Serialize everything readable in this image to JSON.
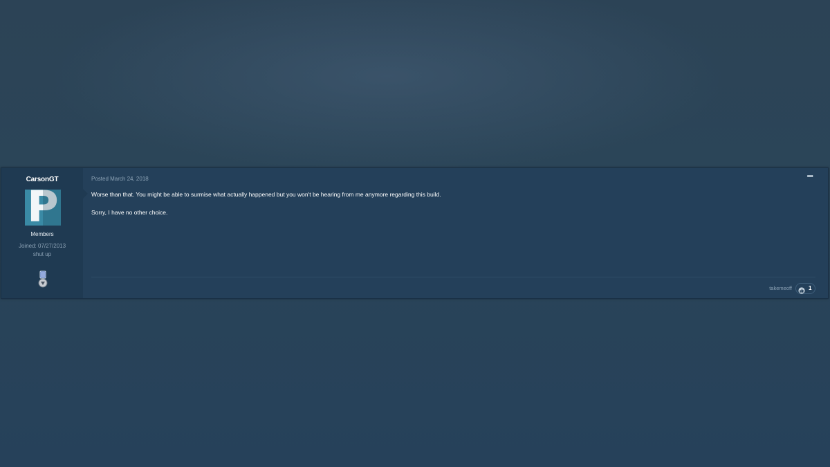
{
  "post": {
    "author": {
      "name": "CarsonGT",
      "avatar_letter": "P",
      "avatar_color": "#3a8aa5",
      "group": "Members",
      "joined": "Joined: 07/27/2013",
      "tagline": "shut up",
      "badge_icon": "rank-badge-icon"
    },
    "meta": {
      "posted": "Posted March 24, 2018"
    },
    "menu_label": "•••",
    "content": {
      "paragraph_1": "Worse than that. You might be able to surmise what actually happened but you won't be hearing from me anymore regarding this build.",
      "paragraph_2": "Sorry, I have no other choice."
    },
    "reactions": {
      "reactor": "takemeoff",
      "icon": "like-reaction-icon",
      "count": "1"
    }
  },
  "colors": {
    "page_background": "#284257",
    "post_background": "#24405a",
    "author_panel": "#1f3a52",
    "muted_text": "#8da3b6"
  }
}
